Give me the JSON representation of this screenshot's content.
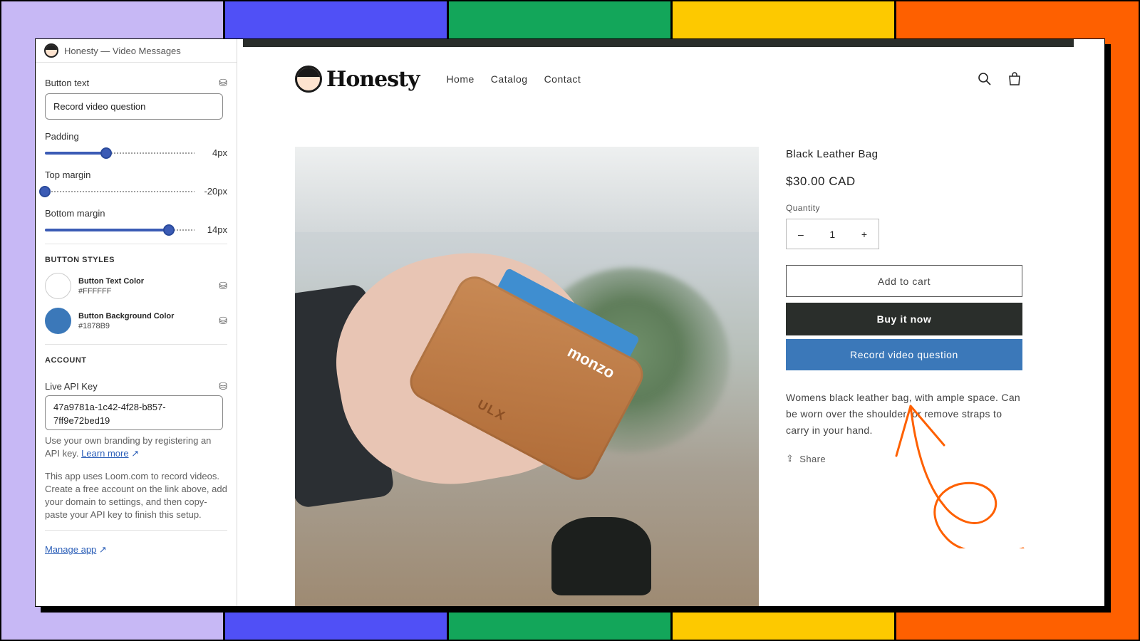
{
  "background_stripes": [
    "#c7b8f5",
    "#5050f6",
    "#13a65a",
    "#fdc900",
    "#fe6000"
  ],
  "sidebar": {
    "header_title": "Honesty — Video Messages",
    "button_text_label": "Button text",
    "button_text_value": "Record video question",
    "sliders": [
      {
        "label": "Padding",
        "value_text": "4px",
        "fill_percent": 41
      },
      {
        "label": "Top margin",
        "value_text": "-20px",
        "fill_percent": 0
      },
      {
        "label": "Bottom margin",
        "value_text": "14px",
        "fill_percent": 83
      }
    ],
    "button_styles_title": "BUTTON STYLES",
    "colors": [
      {
        "name": "Button Text Color",
        "hex": "#FFFFFF"
      },
      {
        "name": "Button Background Color",
        "hex": "#1878B9"
      }
    ],
    "account_title": "ACCOUNT",
    "api_key_label": "Live API Key",
    "api_key_value": "47a9781a-1c42-4f28-b857-7ff9e72bed19",
    "branding_help": "Use your own branding by registering an API key.",
    "learn_more": "Learn more",
    "loom_help": "This app uses Loom.com to record videos. Create a free account on the link above, add your domain to settings, and then copy-paste your API key to finish this setup.",
    "manage_app": "Manage app"
  },
  "store": {
    "brand": "Honesty",
    "nav": [
      "Home",
      "Catalog",
      "Contact"
    ],
    "product": {
      "title": "Black Leather Bag",
      "price": "$30.00 CAD",
      "quantity_label": "Quantity",
      "quantity_minus": "–",
      "quantity_value": "1",
      "quantity_plus": "+",
      "add_to_cart": "Add to cart",
      "buy_now": "Buy it now",
      "record_video": "Record video question",
      "description": "Womens black leather bag, with ample space. Can be worn over the shoulder, or remove straps to carry in your hand.",
      "share": "Share",
      "image_text_card": "monzo",
      "image_text_wallet": "ULX"
    }
  },
  "colors": {
    "accent_blue": "#3b78b9",
    "dark": "#2a2e2b",
    "annotation_orange": "#fe6000"
  }
}
